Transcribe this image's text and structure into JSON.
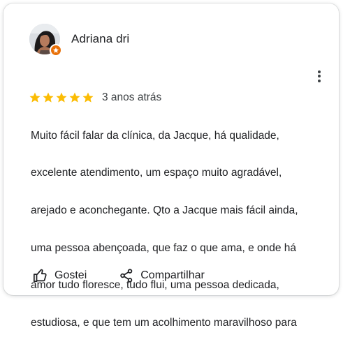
{
  "review": {
    "author": "Adriana dri",
    "avatar_icon": "profile-photo",
    "badge_icon": "local-guide-star-badge",
    "badge_color": "#e8710a",
    "rating": 5,
    "rating_max": 5,
    "star_color": "#fbbc04",
    "date": "3 anos atrás",
    "lines": [
      "Muito fácil falar da clínica,  da Jacque,  há qualidade,",
      "excelente atendimento, um espaço muito agradável,",
      "arejado e aconchegante. Qto a Jacque mais fácil ainda,",
      "uma pessoa abençoada,  que faz o que ama, e onde há",
      "amor tudo floresce, tudo flui,  uma pessoa dedicada,",
      "estudiosa,  e que tem um acolhimento maravilhoso para"
    ]
  },
  "menu": {
    "icon": "more-vert-icon"
  },
  "actions": {
    "like_label": "Gostei",
    "like_icon": "thumb-up-icon",
    "share_label": "Compartilhar",
    "share_icon": "share-icon"
  }
}
